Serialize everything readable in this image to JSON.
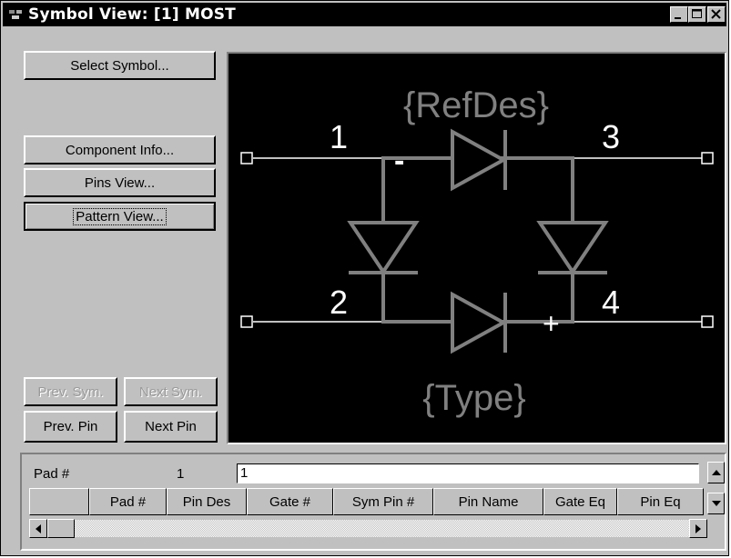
{
  "window": {
    "title": "Symbol View: [1] MOST",
    "controls": {
      "minimize": "_",
      "maximize": "□",
      "close": "×"
    }
  },
  "buttons": {
    "select_symbol": "Select Symbol...",
    "component_info": "Component Info...",
    "pins_view": "Pins View...",
    "pattern_view": "Pattern View...",
    "prev_sym": "Prev. Sym.",
    "next_sym": "Next Sym.",
    "prev_pin": "Prev. Pin",
    "next_pin": "Next Pin"
  },
  "symbol": {
    "refdes_placeholder": "{RefDes}",
    "type_placeholder": "{Type}",
    "pin_labels": [
      "1",
      "2",
      "3",
      "4"
    ],
    "polarity_minus": "-",
    "polarity_plus": "+",
    "colors": {
      "background": "#000000",
      "wire": "#808080",
      "pin": "#ffffff",
      "placeholder": "#808080",
      "label": "#ffffff"
    }
  },
  "pad_table": {
    "pad_label": "Pad #",
    "pad_value": "1",
    "pad_field": "1",
    "columns": [
      "",
      "Pad #",
      "Pin Des",
      "Gate #",
      "Sym Pin #",
      "Pin Name",
      "Gate Eq",
      "Pin Eq"
    ]
  },
  "icons": {
    "scroll_up": "up-arrow-icon",
    "scroll_down": "down-arrow-icon",
    "scroll_left": "left-arrow-icon",
    "scroll_right": "right-arrow-icon"
  }
}
